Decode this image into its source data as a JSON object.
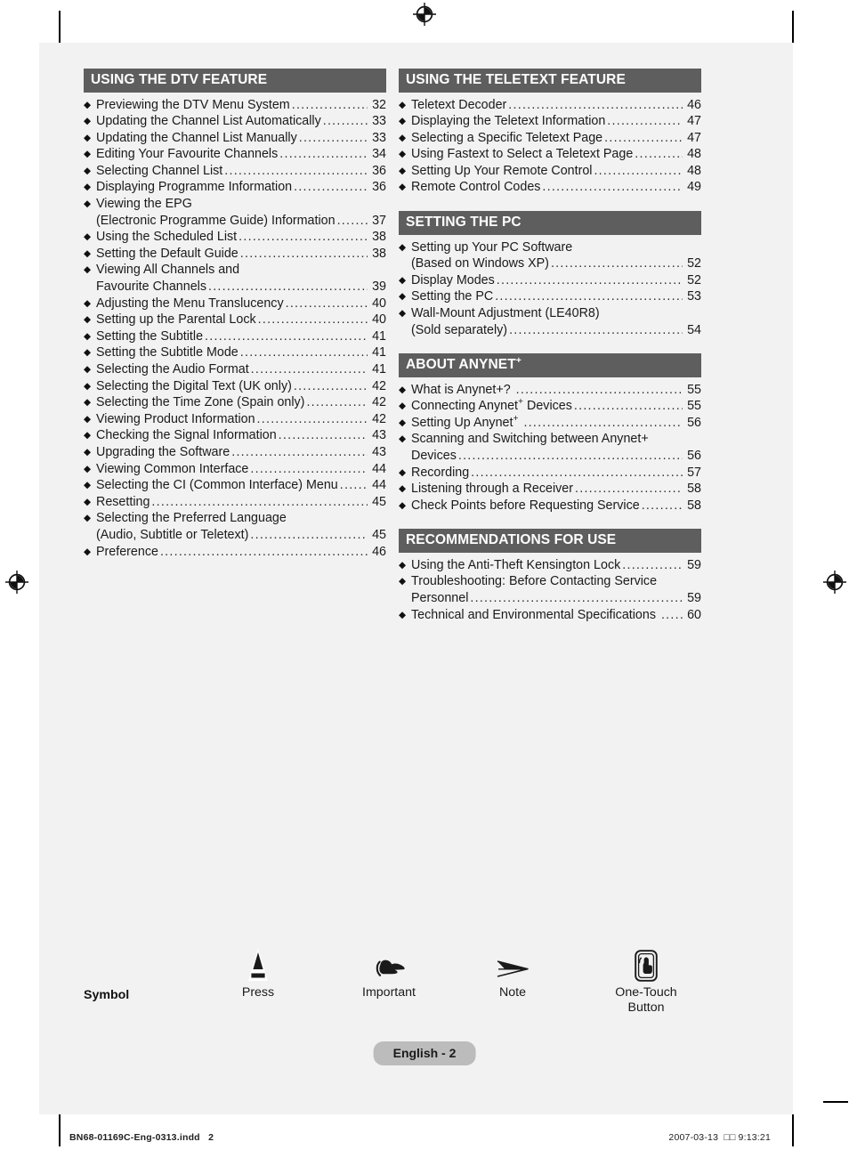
{
  "document": {
    "page_label": "English - 2",
    "prepress_filename": "BN68-01169C-Eng-0313.indd   2",
    "prepress_timestamp": "2007-03-13  □□ 9:13:21"
  },
  "colors": {
    "section_header_bg": "#5e5e5e",
    "section_header_text": "#ffffff",
    "page_bg": "#f2f2f2",
    "pill_bg": "#bcbcbc",
    "body_text": "#1a1a1a"
  },
  "toc": {
    "left_column": [
      {
        "title": "USING THE DTV FEATURE",
        "items": [
          {
            "lines": [
              "Previewing the DTV Menu System"
            ],
            "page": "32"
          },
          {
            "lines": [
              "Updating the Channel List Automatically"
            ],
            "page": "33"
          },
          {
            "lines": [
              "Updating the Channel List Manually"
            ],
            "page": "33"
          },
          {
            "lines": [
              "Editing Your Favourite Channels"
            ],
            "page": "34"
          },
          {
            "lines": [
              "Selecting Channel List"
            ],
            "page": "36"
          },
          {
            "lines": [
              "Displaying Programme Information"
            ],
            "page": "36"
          },
          {
            "lines": [
              "Viewing the EPG",
              "(Electronic Programme Guide) Information"
            ],
            "page": "37"
          },
          {
            "lines": [
              "Using the Scheduled List"
            ],
            "page": "38"
          },
          {
            "lines": [
              "Setting the Default Guide"
            ],
            "page": "38"
          },
          {
            "lines": [
              "Viewing All Channels and",
              "Favourite Channels"
            ],
            "page": "39"
          },
          {
            "lines": [
              "Adjusting the Menu Translucency"
            ],
            "page": "40"
          },
          {
            "lines": [
              "Setting up the Parental Lock"
            ],
            "page": "40"
          },
          {
            "lines": [
              "Setting the Subtitle"
            ],
            "page": "41"
          },
          {
            "lines": [
              "Setting the Subtitle Mode"
            ],
            "page": "41"
          },
          {
            "lines": [
              "Selecting the Audio Format"
            ],
            "page": "41"
          },
          {
            "lines": [
              "Selecting the Digital Text (UK only)"
            ],
            "page": "42"
          },
          {
            "lines": [
              "Selecting the Time Zone (Spain only)"
            ],
            "page": "42"
          },
          {
            "lines": [
              "Viewing Product Information"
            ],
            "page": "42"
          },
          {
            "lines": [
              "Checking the Signal Information"
            ],
            "page": "43"
          },
          {
            "lines": [
              "Upgrading the Software"
            ],
            "page": "43"
          },
          {
            "lines": [
              "Viewing Common Interface"
            ],
            "page": "44"
          },
          {
            "lines": [
              "Selecting the CI (Common Interface) Menu"
            ],
            "page": "44"
          },
          {
            "lines": [
              "Resetting"
            ],
            "page": "45"
          },
          {
            "lines": [
              "Selecting the Preferred Language",
              "(Audio, Subtitle or Teletext)"
            ],
            "page": "45"
          },
          {
            "lines": [
              "Preference"
            ],
            "page": "46"
          }
        ]
      }
    ],
    "right_column": [
      {
        "title": "USING THE TELETEXT FEATURE",
        "items": [
          {
            "lines": [
              "Teletext Decoder"
            ],
            "page": "46"
          },
          {
            "lines": [
              "Displaying the Teletext Information"
            ],
            "page": "47"
          },
          {
            "lines": [
              "Selecting a Specific Teletext Page"
            ],
            "page": "47"
          },
          {
            "lines": [
              "Using Fastext to Select a Teletext Page"
            ],
            "page": "48"
          },
          {
            "lines": [
              "Setting Up Your Remote Control"
            ],
            "page": "48"
          },
          {
            "lines": [
              "Remote Control Codes"
            ],
            "page": "49"
          }
        ]
      },
      {
        "title": "SETTING THE PC",
        "items": [
          {
            "lines": [
              "Setting up Your PC Software",
              "(Based on Windows XP)"
            ],
            "page": "52"
          },
          {
            "lines": [
              "Display Modes"
            ],
            "page": "52"
          },
          {
            "lines": [
              "Setting the PC"
            ],
            "page": "53"
          },
          {
            "lines": [
              "Wall-Mount Adjustment (LE40R8)",
              "(Sold separately)"
            ],
            "page": "54"
          }
        ]
      },
      {
        "title": "ABOUT ANYNET",
        "title_sup": "+",
        "items": [
          {
            "lines": [
              "What is Anynet+? "
            ],
            "page": "55"
          },
          {
            "lines": [
              "Connecting Anynet|+| Devices"
            ],
            "page": "55"
          },
          {
            "lines": [
              "Setting Up Anynet|+| "
            ],
            "page": "56"
          },
          {
            "lines": [
              "Scanning and Switching between Anynet+",
              "Devices"
            ],
            "page": "56"
          },
          {
            "lines": [
              "Recording"
            ],
            "page": "57"
          },
          {
            "lines": [
              "Listening through a Receiver"
            ],
            "page": "58"
          },
          {
            "lines": [
              "Check Points before Requesting Service"
            ],
            "page": "58"
          }
        ]
      },
      {
        "title": "RECOMMENDATIONS FOR USE",
        "items": [
          {
            "lines": [
              "Using the Anti-Theft Kensington Lock"
            ],
            "page": "59"
          },
          {
            "lines": [
              "Troubleshooting: Before Contacting Service",
              "Personnel"
            ],
            "page": "59"
          },
          {
            "lines": [
              "Technical and Environmental Specifications "
            ],
            "page": "60"
          }
        ]
      }
    ]
  },
  "legend": {
    "title": "Symbol",
    "items": [
      {
        "icon": "press-triangle-icon",
        "label": "Press"
      },
      {
        "icon": "pointing-hand-icon",
        "label": "Important"
      },
      {
        "icon": "arrow-note-icon",
        "label": "Note"
      },
      {
        "icon": "one-touch-button-icon",
        "label": "One-Touch\nButton"
      }
    ]
  }
}
